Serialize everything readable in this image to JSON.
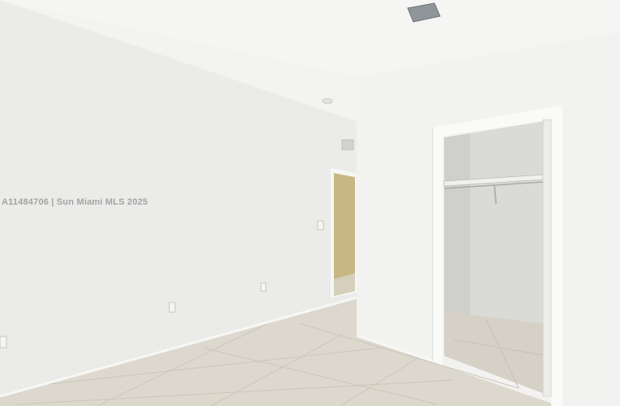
{
  "photo": {
    "watermark": "A11484706 | Sun Miami MLS 2025"
  },
  "colors": {
    "ceiling": "#f4f4f3",
    "left_wall": "#ececea",
    "right_wall": "#f1f1ef",
    "floor": "#dcd7cc",
    "closet_interior": "#d9d9d6",
    "hall_light": "#c9b98a"
  }
}
